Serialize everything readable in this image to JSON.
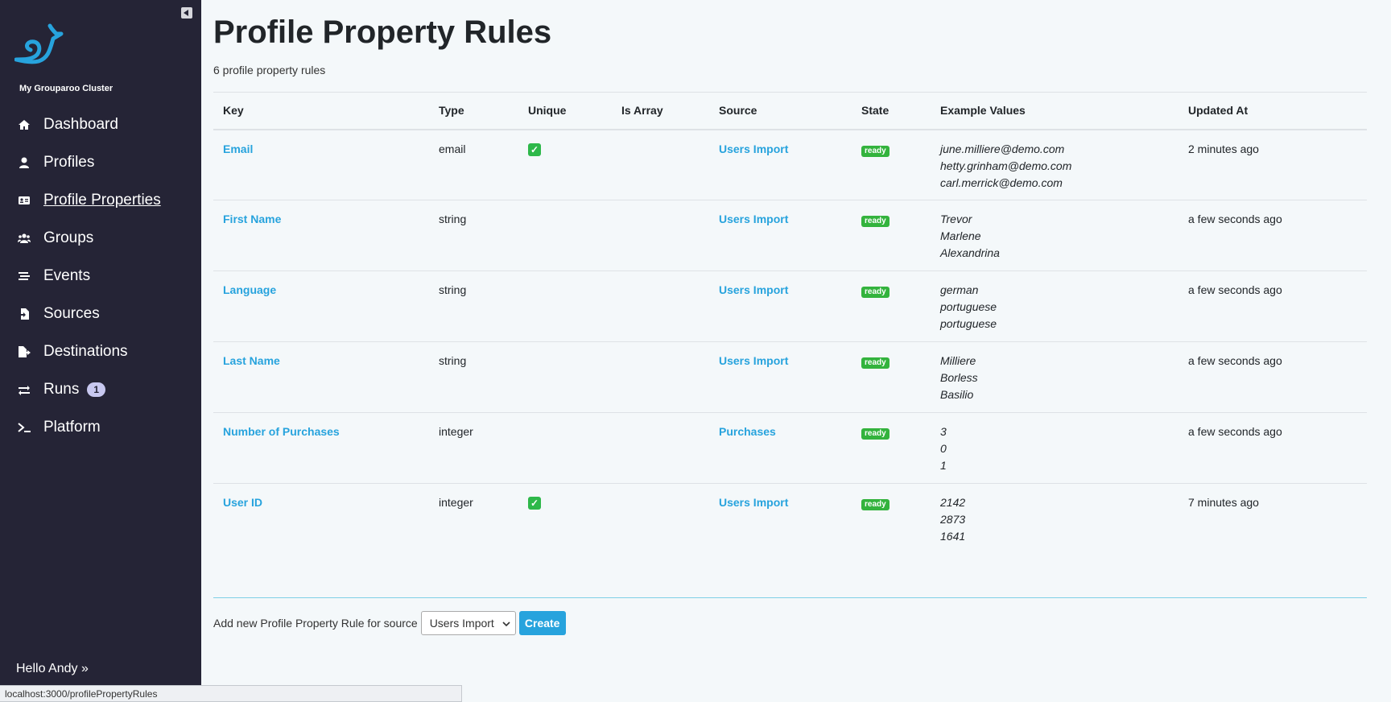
{
  "sidebar": {
    "cluster_name": "My Grouparoo Cluster",
    "items": [
      {
        "label": "Dashboard",
        "icon": "home-icon"
      },
      {
        "label": "Profiles",
        "icon": "user-icon"
      },
      {
        "label": "Profile Properties",
        "icon": "id-card-icon"
      },
      {
        "label": "Groups",
        "icon": "users-icon"
      },
      {
        "label": "Events",
        "icon": "stream-icon"
      },
      {
        "label": "Sources",
        "icon": "file-import-icon"
      },
      {
        "label": "Destinations",
        "icon": "file-export-icon"
      },
      {
        "label": "Runs",
        "icon": "exchange-icon",
        "badge": "1"
      },
      {
        "label": "Platform",
        "icon": "terminal-icon"
      }
    ],
    "hello": "Hello Andy »",
    "status_url": "localhost:3000/profilePropertyRules"
  },
  "page": {
    "title": "Profile Property Rules",
    "subtitle": "6 profile property rules"
  },
  "table": {
    "headers": [
      "Key",
      "Type",
      "Unique",
      "Is Array",
      "Source",
      "State",
      "Example Values",
      "Updated At"
    ],
    "rows": [
      {
        "key": "Email",
        "type": "email",
        "unique": true,
        "source": "Users Import",
        "state": "ready",
        "examples": [
          "june.milliere@demo.com",
          "hetty.grinham@demo.com",
          "carl.merrick@demo.com"
        ],
        "updated": "2 minutes ago"
      },
      {
        "key": "First Name",
        "type": "string",
        "unique": false,
        "source": "Users Import",
        "state": "ready",
        "examples": [
          "Trevor",
          "Marlene",
          "Alexandrina"
        ],
        "updated": "a few seconds ago"
      },
      {
        "key": "Language",
        "type": "string",
        "unique": false,
        "source": "Users Import",
        "state": "ready",
        "examples": [
          "german",
          "portuguese",
          "portuguese"
        ],
        "updated": "a few seconds ago"
      },
      {
        "key": "Last Name",
        "type": "string",
        "unique": false,
        "source": "Users Import",
        "state": "ready",
        "examples": [
          "Milliere",
          "Borless",
          "Basilio"
        ],
        "updated": "a few seconds ago"
      },
      {
        "key": "Number of Purchases",
        "type": "integer",
        "unique": false,
        "source": "Purchases",
        "state": "ready",
        "examples": [
          "3",
          "0",
          "1"
        ],
        "updated": "a few seconds ago"
      },
      {
        "key": "User ID",
        "type": "integer",
        "unique": true,
        "source": "Users Import",
        "state": "ready",
        "examples": [
          "2142",
          "2873",
          "1641"
        ],
        "updated": "7 minutes ago"
      }
    ]
  },
  "footer": {
    "add_label": "Add new Profile Property Rule for source",
    "select_value": "Users Import",
    "create_label": "Create"
  },
  "colors": {
    "sidebar_bg": "#252436",
    "link": "#27a3dd",
    "ready_badge": "#33b33d",
    "page_bg": "#f4f8fa"
  }
}
